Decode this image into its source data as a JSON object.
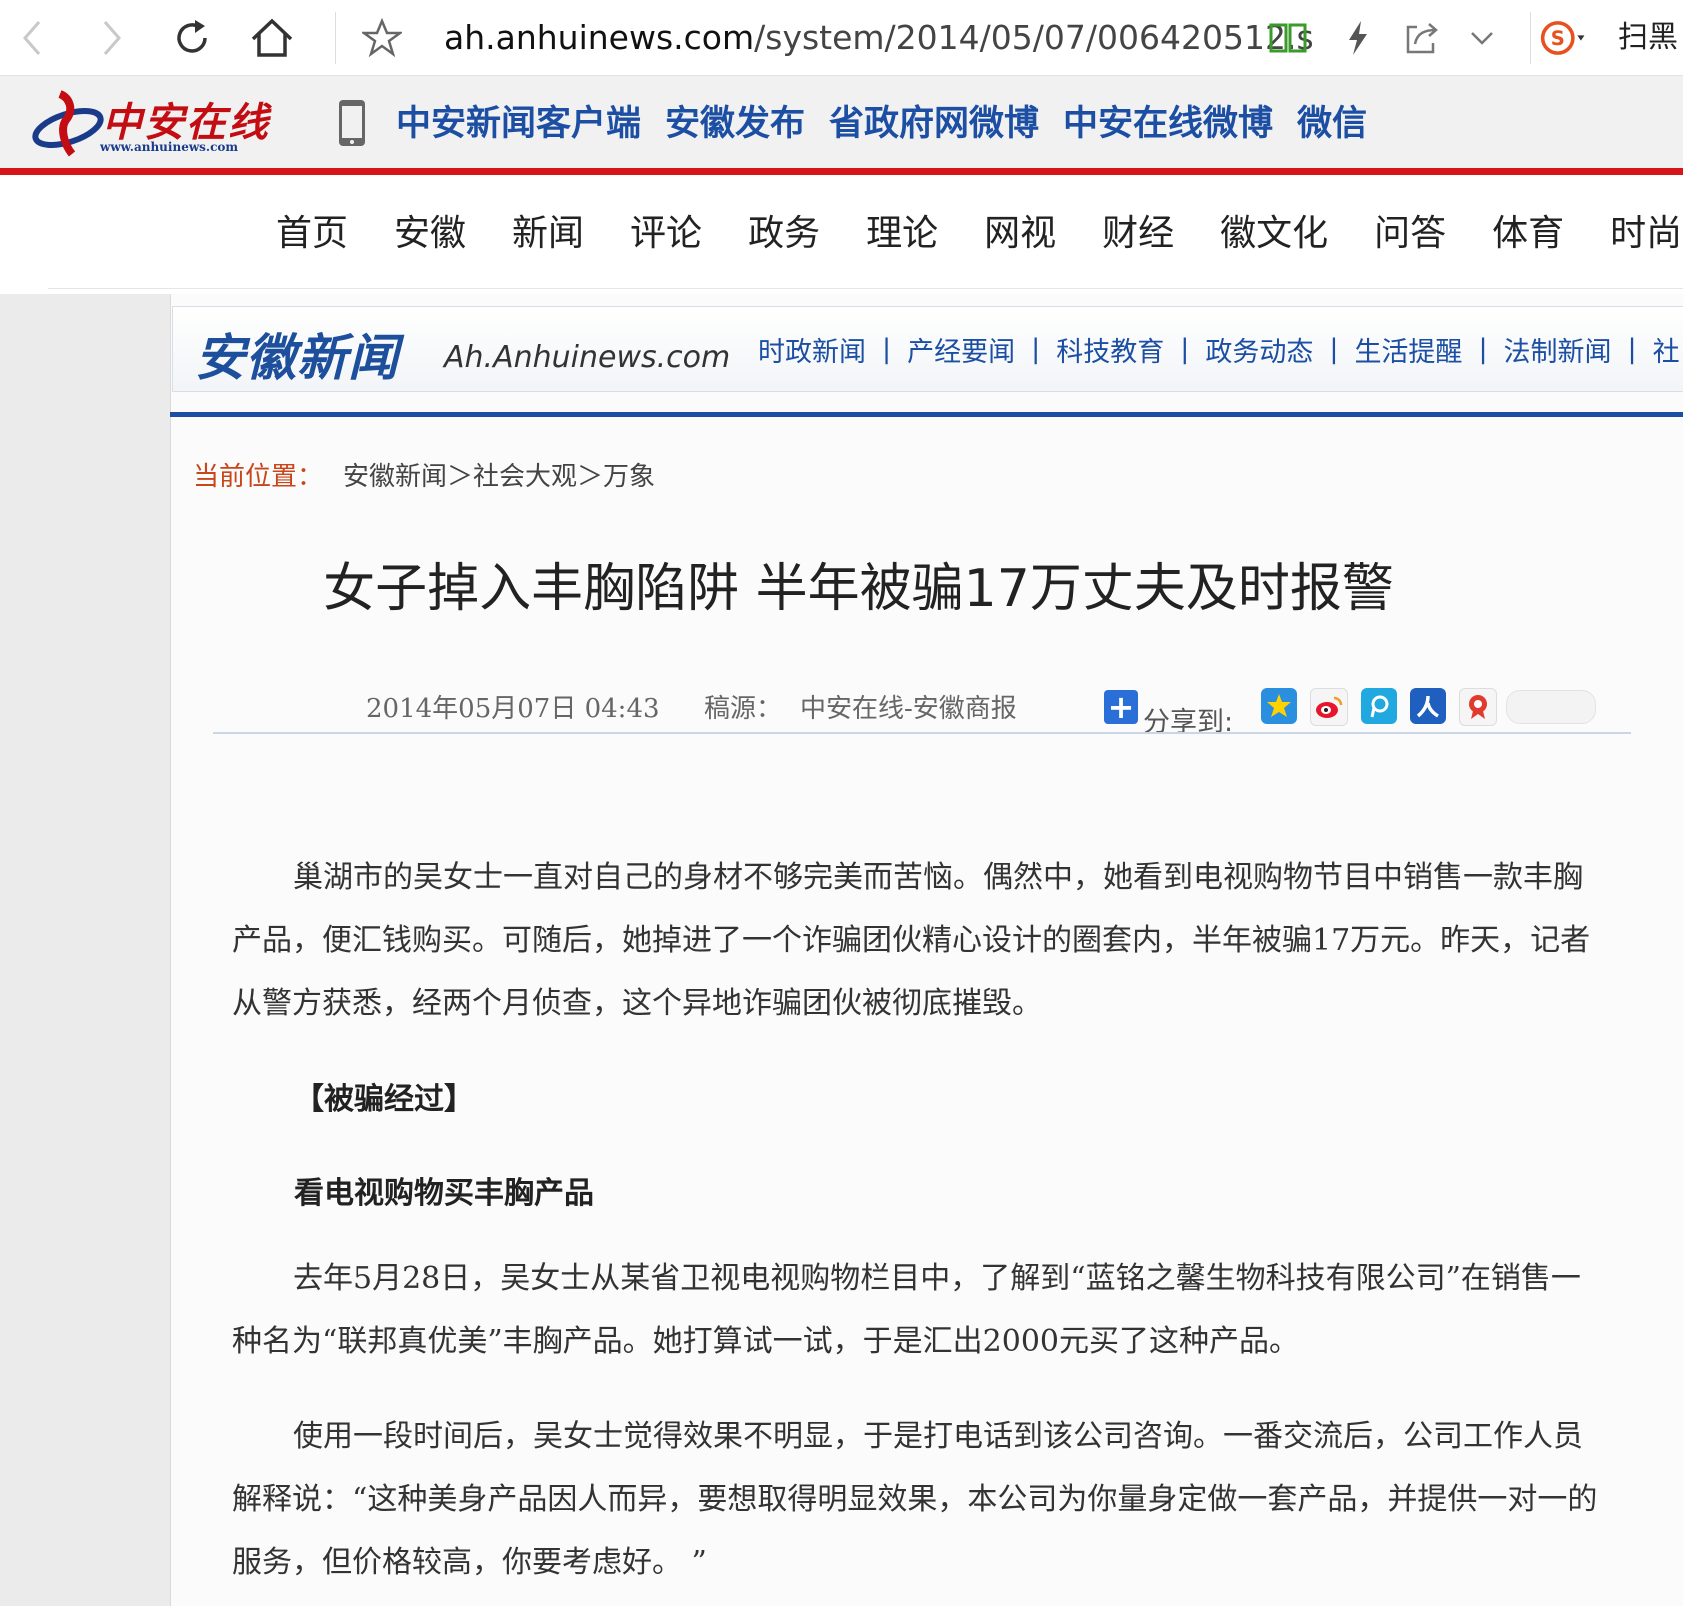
{
  "browser": {
    "url_host": "ah.anhuinews.com",
    "url_path": "/system/2014/05/07/006420512.s",
    "scan_label": "扫黑",
    "icons": [
      "back-icon",
      "forward-icon",
      "reload-icon",
      "home-icon",
      "star-icon",
      "reader-icon",
      "lightning-icon",
      "share-out-icon",
      "chevron-down-icon",
      "sogou-icon"
    ]
  },
  "site_header": {
    "logo_text": "中安在线",
    "logo_sub": "www.anhuinews.com",
    "links": [
      "中安新闻客户端",
      "安徽发布",
      "省政府网微博",
      "中安在线微博",
      "微信"
    ]
  },
  "main_nav": [
    "首页",
    "安徽",
    "新闻",
    "评论",
    "政务",
    "理论",
    "网视",
    "财经",
    "徽文化",
    "问答",
    "体育",
    "时尚"
  ],
  "sub_banner": {
    "title": "安徽新闻",
    "domain": "Ah.Anhuinews.com",
    "nav": [
      "时政新闻",
      "产经要闻",
      "科技教育",
      "政务动态",
      "生活提醒",
      "法制新闻",
      "社"
    ]
  },
  "breadcrumb": {
    "label": "当前位置：",
    "path": "安徽新闻＞社会大观＞万象"
  },
  "article": {
    "title": "女子掉入丰胸陷阱 半年被骗17万丈夫及时报警",
    "date": "2014年05月07日  04:43",
    "source_label": "稿源：",
    "source": "中安在线-安徽商报",
    "share_label": "分享到:",
    "paragraphs": [
      "巢湖市的吴女士一直对自己的身材不够完美而苦恼。偶然中，她看到电视购物节目中销售一款丰胸产品，便汇钱购买。可随后，她掉进了一个诈骗团伙精心设计的圈套内，半年被骗17万元。昨天，记者从警方获悉，经两个月侦查，这个异地诈骗团伙被彻底摧毁。",
      "去年5月28日，吴女士从某省卫视电视购物栏目中，了解到“蓝铭之馨生物科技有限公司”在销售一种名为“联邦真优美”丰胸产品。她打算试一试，于是汇出2000元买了这种产品。",
      "使用一段时间后，吴女士觉得效果不明显，于是打电话到该公司咨询。一番交流后，公司工作人员解释说：“这种美身产品因人而异，要想取得明显效果，本公司为你量身定做一套产品，并提供一对一的服务，但价格较高，你要考虑好。 ”"
    ],
    "section_head_1": "【被骗经过】",
    "section_head_2": "看电视购物买丰胸产品"
  },
  "colors": {
    "brand_red": "#d61518",
    "link_blue": "#1c4fa3",
    "breadcrumb_orange": "#c8461a"
  }
}
